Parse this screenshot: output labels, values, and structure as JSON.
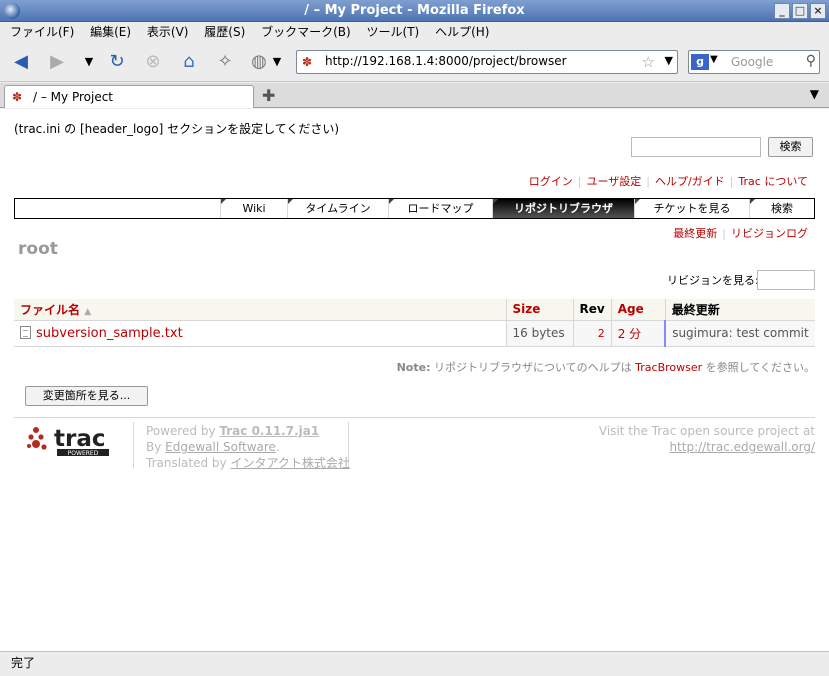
{
  "window": {
    "title": "/ – My Project - Mozilla Firefox"
  },
  "menu": [
    "ファイル(F)",
    "編集(E)",
    "表示(V)",
    "履歴(S)",
    "ブックマーク(B)",
    "ツール(T)",
    "ヘルプ(H)"
  ],
  "nav": {
    "url": "http://192.168.1.4:8000/project/browser",
    "search_placeholder": "Google"
  },
  "tab": {
    "label": "/ – My Project"
  },
  "page": {
    "header_logo_note": "(trac.ini の [header_logo] セクションを設定してください)",
    "search_button": "検索",
    "metanav": [
      "ログイン",
      "ユーザ設定",
      "ヘルプ/ガイド",
      "Trac について"
    ],
    "mainnav": [
      "Wiki",
      "タイムライン",
      "ロードマップ",
      "リポジトリブラウザ",
      "チケットを見る",
      "検索"
    ],
    "ctxtnav": [
      "最終更新",
      "リビジョンログ"
    ],
    "title": "root",
    "rev_label": "リビジョンを見る:",
    "table": {
      "headers": {
        "name": "ファイル名",
        "size": "Size",
        "rev": "Rev",
        "age": "Age",
        "change": "最終更新"
      },
      "sort_arrow": "▲",
      "rows": [
        {
          "name": "subversion_sample.txt",
          "size": "16 bytes",
          "rev": "2",
          "age": "2 分",
          "change": "sugimura: test commit"
        }
      ]
    },
    "help_note": {
      "label": "Note:",
      "text": "リポジトリブラウザについてのヘルプは",
      "link": "TracBrowser",
      "suffix": "を参照してください。"
    },
    "changes_button": "変更箇所を見る...",
    "footer": {
      "powered_by": "Powered by",
      "trac_version": "Trac 0.11.7.ja1",
      "by": "By",
      "edgewall": "Edgewall Software",
      "period": ".",
      "translated_by": "Translated by",
      "interact": "インタアクト株式会社",
      "visit_text": "Visit the Trac open source project at",
      "visit_url": "http://trac.edgewall.org/",
      "logo_text": "trac",
      "logo_sub": "POWERED"
    }
  },
  "status": {
    "text": "完了"
  },
  "colors": {
    "link": "#bb0000",
    "active_tab_bg": "#000000"
  }
}
